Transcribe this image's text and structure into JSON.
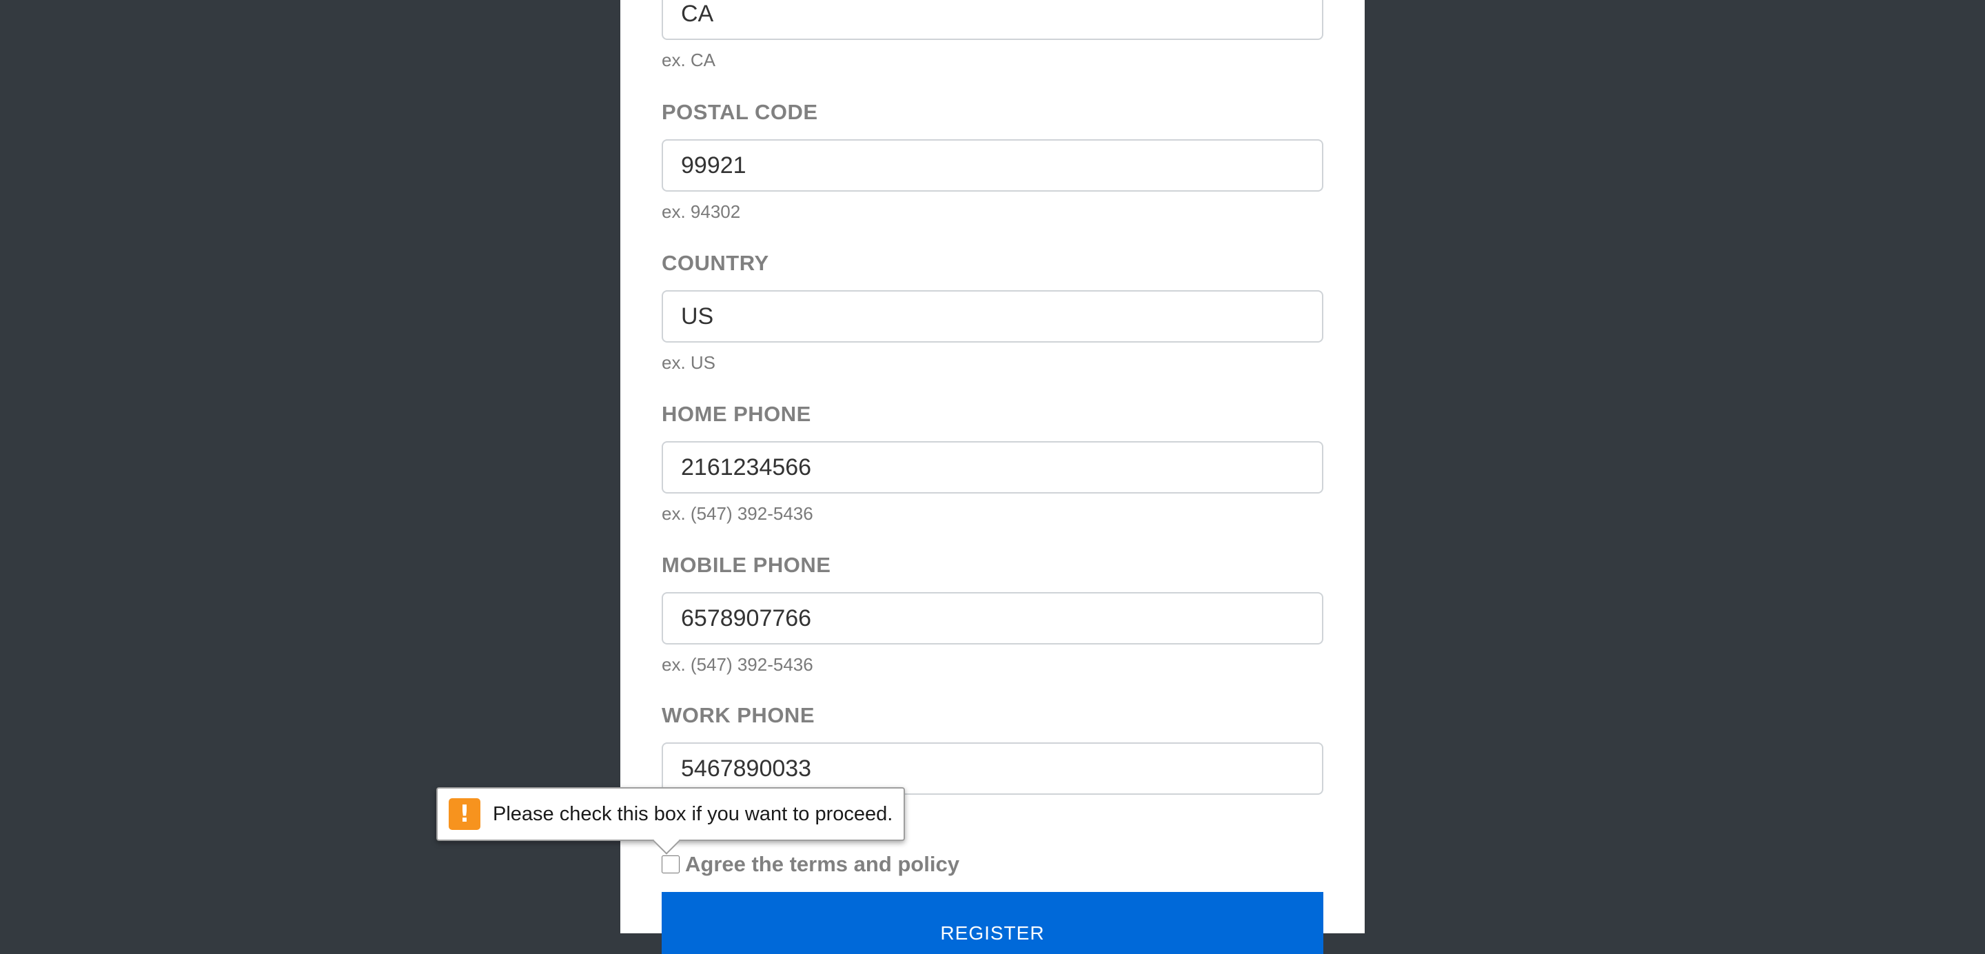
{
  "form": {
    "state": {
      "value": "CA",
      "hint": "ex. CA"
    },
    "postal_code": {
      "label": "POSTAL CODE",
      "value": "99921",
      "hint": "ex. 94302"
    },
    "country": {
      "label": "COUNTRY",
      "value": "US",
      "hint": "ex. US"
    },
    "home_phone": {
      "label": "HOME PHONE",
      "value": "2161234566",
      "hint": "ex. (547) 392-5436"
    },
    "mobile_phone": {
      "label": "MOBILE PHONE",
      "value": "6578907766",
      "hint": "ex. (547) 392-5436"
    },
    "work_phone": {
      "label": "WORK PHONE",
      "value": "5467890033"
    },
    "agree_label": "Agree the terms and policy",
    "agree_checked": false,
    "register_label": "REGISTER"
  },
  "validation_tooltip": {
    "icon": "warning-icon",
    "message": "Please check this box if you want to proceed."
  },
  "colors": {
    "background": "#343a40",
    "panel": "#ffffff",
    "primary_button": "#0069d9",
    "warning": "#f7931e"
  }
}
